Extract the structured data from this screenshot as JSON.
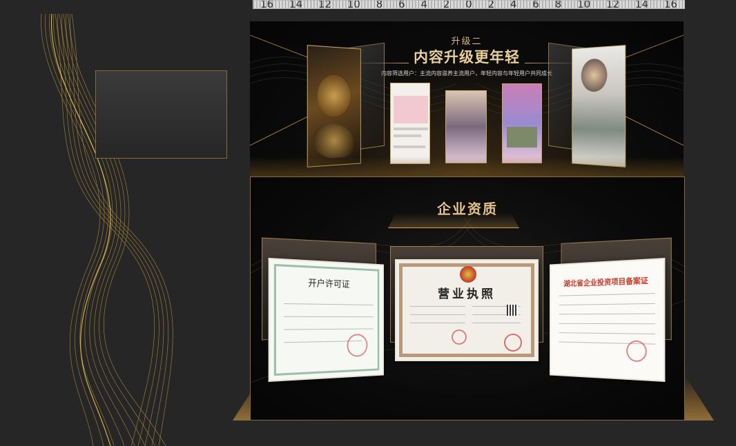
{
  "ruler": {
    "numbers": [
      "16",
      "14",
      "12",
      "10",
      "8",
      "6",
      "4",
      "2",
      "0",
      "2",
      "4",
      "6",
      "8",
      "10",
      "12",
      "14",
      "16"
    ]
  },
  "upgrade_section": {
    "label": "升级二",
    "title": "内容升级更年轻",
    "subtitle": "内容筛选用户：主流内容滋养主流用户，年轻内容与年轻用户共同成长"
  },
  "qualification_section": {
    "title": "企业资质",
    "certificates": [
      {
        "title": "开户许可证"
      },
      {
        "title": "营业执照"
      },
      {
        "title": "湖北省企业投资项目备案证"
      }
    ]
  },
  "colors": {
    "gold": "#c9a15c",
    "background": "#262626",
    "panel": "#050505"
  }
}
